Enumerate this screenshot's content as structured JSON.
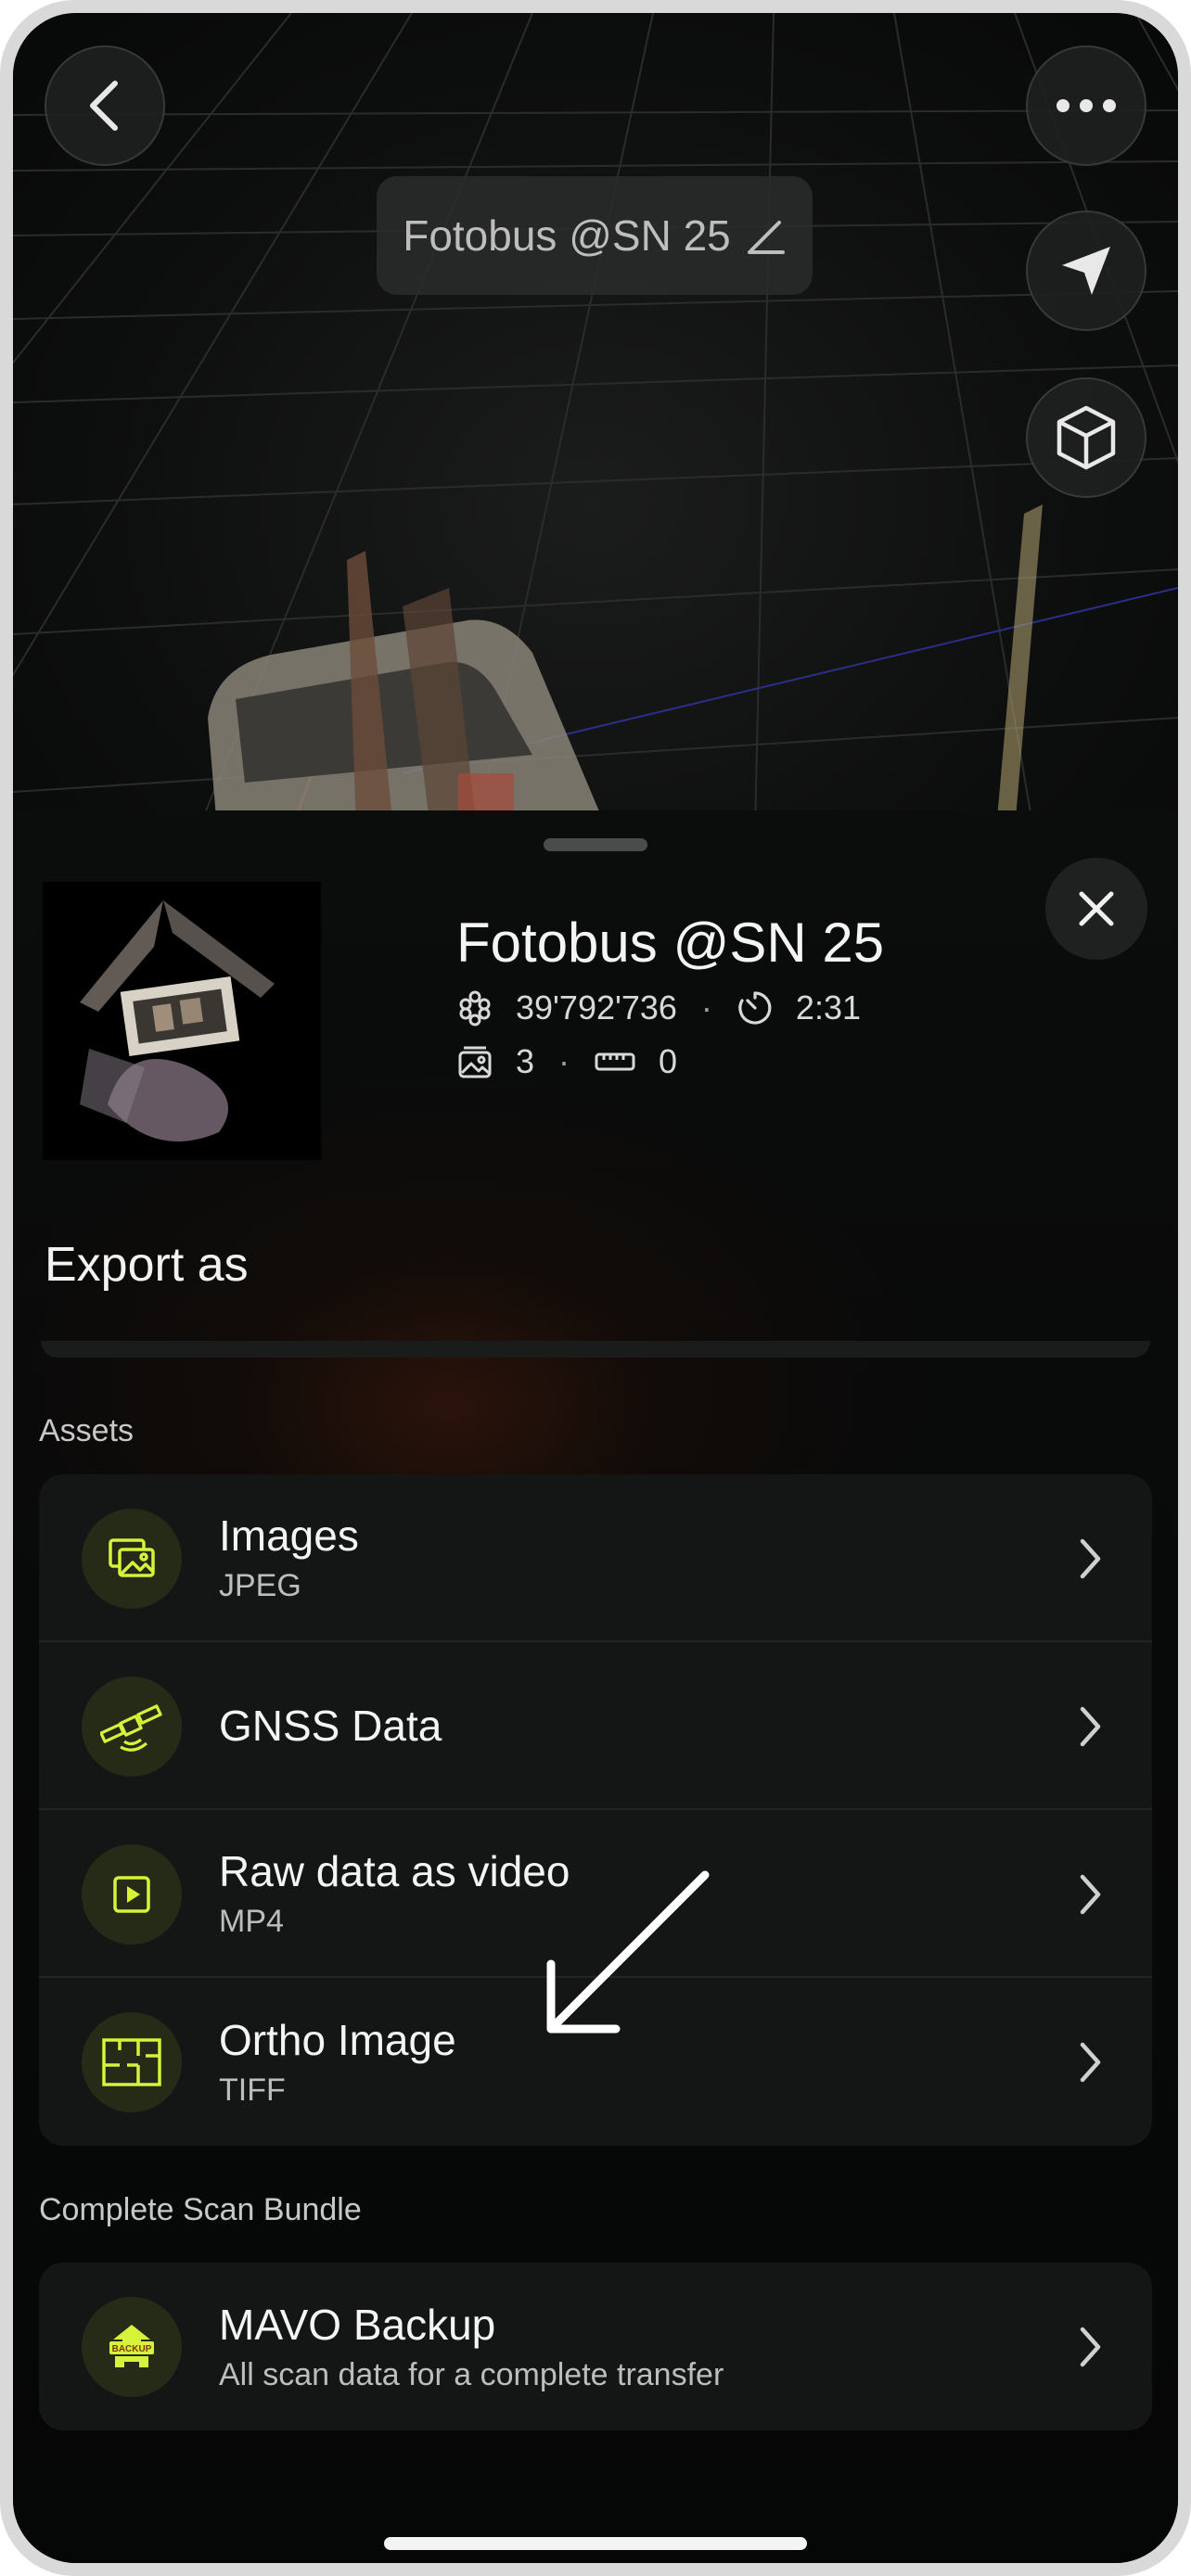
{
  "viewer": {
    "title": "Fotobus @SN 25",
    "back_icon": "chevron-left-icon",
    "more_icon": "more-horizontal-icon",
    "locate_icon": "navigation-arrow-icon",
    "view_icon": "cube-icon",
    "edit_icon": "pencil-icon"
  },
  "sheet": {
    "close_icon": "close-icon",
    "scan": {
      "title": "Fotobus @SN 25",
      "points": "39'792'736",
      "duration": "2:31",
      "images": "3",
      "measurements": "0"
    },
    "export_title": "Export as",
    "assets_label": "Assets",
    "assets": [
      {
        "label": "Images",
        "sub": "JPEG",
        "icon": "images-icon"
      },
      {
        "label": "GNSS Data",
        "sub": "",
        "icon": "satellite-icon"
      },
      {
        "label": "Raw data as video",
        "sub": "MP4",
        "icon": "video-play-icon"
      },
      {
        "label": "Ortho Image",
        "sub": "TIFF",
        "icon": "floorplan-icon"
      }
    ],
    "bundle_label": "Complete Scan Bundle",
    "bundle": {
      "label": "MAVO Backup",
      "sub": "All scan data for a complete transfer",
      "icon": "backup-icon",
      "icon_text": "BACKUP"
    }
  },
  "colors": {
    "accent": "#d7f23a",
    "icon_bg": "#252b17",
    "card_bg": "#141616",
    "annotation": "#ffffff"
  }
}
